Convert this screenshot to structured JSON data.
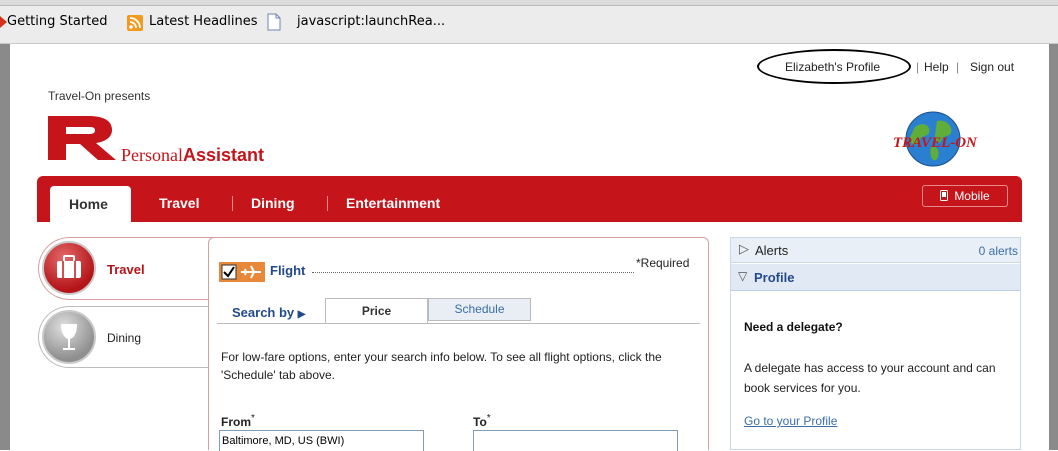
{
  "bookmarks": {
    "getting_started": "Getting Started",
    "latest_headlines": "Latest Headlines",
    "launch": "javascript:launchRea..."
  },
  "toplinks": {
    "profile": "Elizabeth's Profile",
    "help": "Help",
    "signout": "Sign out",
    "sep": "|"
  },
  "brand": {
    "presents": "Travel-On presents",
    "personal": "Personal",
    "assistant": "Assistant",
    "partner_logo": "TRAVEL-ON"
  },
  "nav": {
    "home": "Home",
    "travel": "Travel",
    "dining": "Dining",
    "entertainment": "Entertainment",
    "mobile": "Mobile"
  },
  "side": {
    "travel": "Travel",
    "dining": "Dining"
  },
  "flight": {
    "label": "Flight",
    "required": "*Required",
    "search_by": "Search by",
    "tab_price": "Price",
    "tab_schedule": "Schedule",
    "intro": "For low-fare options, enter your search info below. To see all flight options, click the 'Schedule' tab above.",
    "from_label": "From",
    "to_label": "To",
    "from_value": "Baltimore, MD, US (BWI)",
    "to_value": ""
  },
  "right": {
    "alerts": "Alerts",
    "alerts_count": "0 alerts",
    "profile": "Profile",
    "delegate_heading": "Need a delegate?",
    "delegate_text": "A delegate has access to your account and can book services for you.",
    "goto_profile": "Go to your Profile"
  },
  "colors": {
    "brand_red": "#c5151b",
    "link_blue": "#3c6ea8",
    "panel_blue": "#e1eaf4"
  }
}
